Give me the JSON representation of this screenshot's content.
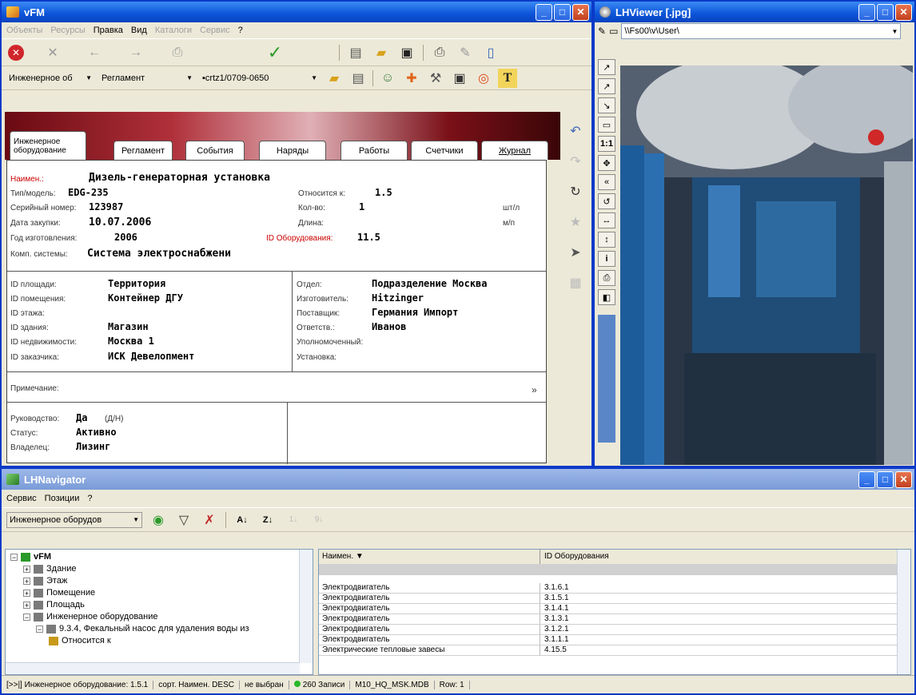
{
  "vfm": {
    "title": "vFM",
    "menu": [
      "Объекты",
      "Ресурсы",
      "Правка",
      "Вид",
      "Каталоги",
      "Сервис",
      "?"
    ],
    "combos": {
      "object": "Инженерное об",
      "type": "Регламент",
      "code": "crtz1/0709-0650"
    },
    "tabs": [
      "Инженерное оборудование",
      "Регламент",
      "События",
      "Наряды",
      "Работы",
      "Счетчики",
      "Журнал"
    ],
    "form": {
      "name_label": "Наимен.:",
      "name_value": "Дизель-генераторная установка",
      "model_label": "Тип/модель:",
      "model_value": "EDG-235",
      "relative_label": "Относится к:",
      "relative_value": "1.5",
      "serial_label": "Серийный номер:",
      "serial_value": "123987",
      "qty_label": "Кол-во:",
      "qty_value": "1",
      "qty_unit": "шт/л",
      "purchase_label": "Дата закупки:",
      "purchase_value": "10.07.2006",
      "length_label": "Длина:",
      "length_unit": "м/п",
      "year_label": "Год изготовления:",
      "year_value": "2006",
      "equip_id_label": "ID Оборудования:",
      "equip_id_value": "11.5",
      "system_label": "Комп. системы:",
      "system_value": "Система электроснабжени",
      "area_label": "ID площади:",
      "area_value": "Территория",
      "room_label": "ID помещения:",
      "room_value": "Контейнер ДГУ",
      "floor_label": "ID этажа:",
      "floor_value": "",
      "building_label": "ID здания:",
      "building_value": "Магазин",
      "realty_label": "ID недвижимости:",
      "realty_value": "Москва 1",
      "customer_label": "ID заказчика:",
      "customer_value": "ИСК Девелопмент",
      "dept_label": "Отдел:",
      "dept_value": "Подразделение Москва",
      "maker_label": "Изготовитель:",
      "maker_value": "Hitzinger",
      "supplier_label": "Поставщик:",
      "supplier_value": "Германия Импорт",
      "resp_label": "Ответств.:",
      "resp_value": "Иванов",
      "auth_label": "Уполномоченный:",
      "install_label": "Установка:",
      "notes_label": "Примечание:",
      "notes_more": "»",
      "guide_label": "Руководство:",
      "guide_value": "Да",
      "guide_hint": "(Д/Н)",
      "status_label": "Статус:",
      "status_value": "Активно",
      "owner_label": "Владелец:",
      "owner_value": "Лизинг"
    }
  },
  "viewer": {
    "title": "LHViewer [.jpg]",
    "path": "\\\\Fs00\\v\\User\\"
  },
  "navigator": {
    "title": "LHNavigator",
    "menu": [
      "Сервис",
      "Позиции",
      "?"
    ],
    "combo": "Инженерное оборудов",
    "tree": [
      {
        "label": "vFM",
        "level": 0,
        "exp": "−"
      },
      {
        "label": "Здание",
        "level": 1,
        "exp": "+"
      },
      {
        "label": "Этаж",
        "level": 1,
        "exp": "+"
      },
      {
        "label": "Помещение",
        "level": 1,
        "exp": "+"
      },
      {
        "label": "Площадь",
        "level": 1,
        "exp": "+"
      },
      {
        "label": "Инженерное оборудование",
        "level": 1,
        "exp": "−"
      },
      {
        "label": "9.3.4, Фекальный насос для удаления воды из",
        "level": 2,
        "exp": "−"
      },
      {
        "label": "Относится к",
        "level": 3,
        "exp": ""
      }
    ],
    "grid": {
      "col1": "Наимен. ▼",
      "col2": "ID Оборудования",
      "rows": [
        [
          "Электродвигатель",
          "3.1.6.1"
        ],
        [
          "Электродвигатель",
          "3.1.5.1"
        ],
        [
          "Электродвигатель",
          "3.1.4.1"
        ],
        [
          "Электродвигатель",
          "3.1.3.1"
        ],
        [
          "Электродвигатель",
          "3.1.2.1"
        ],
        [
          "Электродвигатель",
          "3.1.1.1"
        ],
        [
          "Электрические тепловые завесы",
          "4.15.5"
        ]
      ]
    },
    "status": [
      "[>>|] Инженерное оборудование: 1.5.1",
      "сорт. Наимен. DESC",
      "не выбран",
      "260 Записи",
      "M10_HQ_MSK.MDB",
      "Row: 1"
    ]
  }
}
